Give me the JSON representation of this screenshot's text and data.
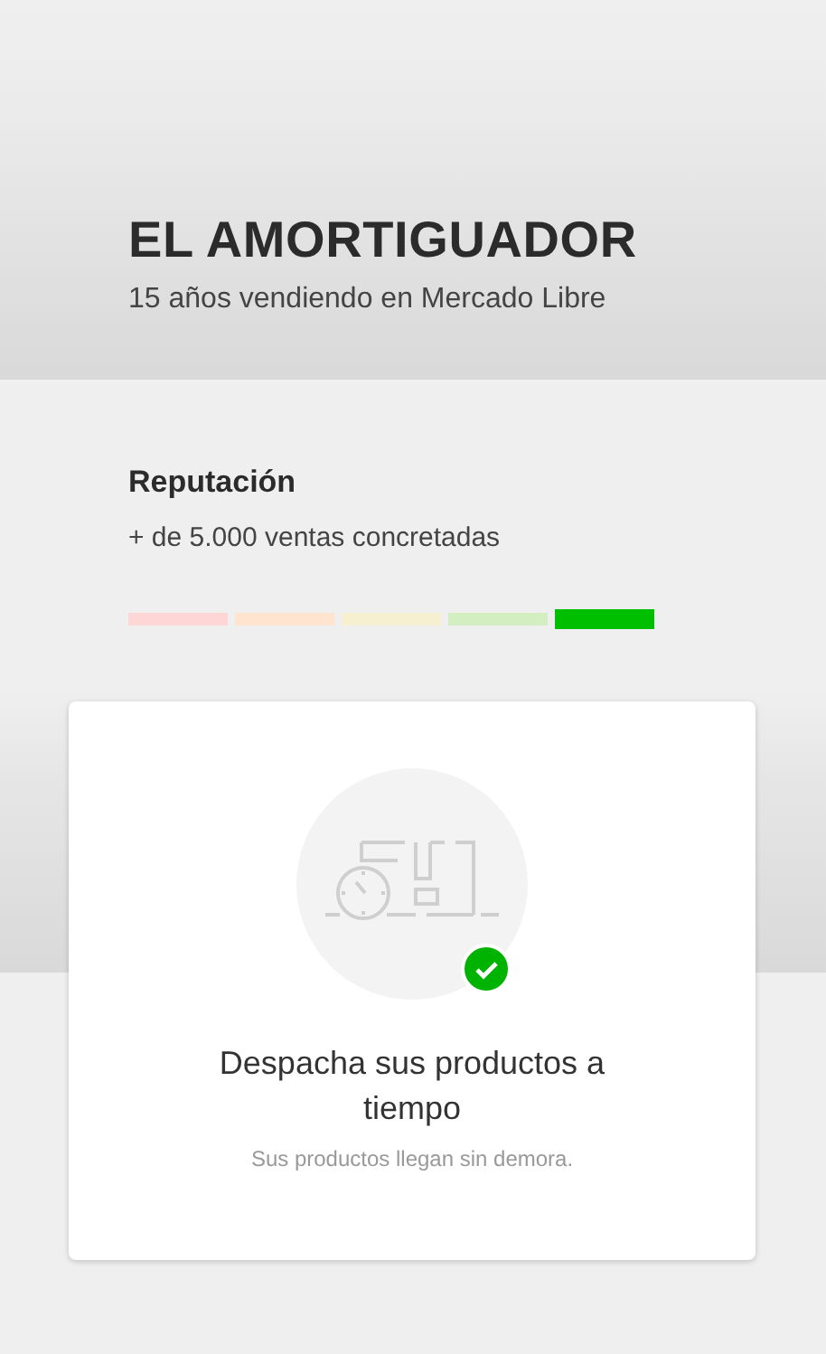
{
  "seller": {
    "name": "EL AMORTIGUADOR",
    "subtitle": "15 años vendiendo en Mercado Libre"
  },
  "reputation": {
    "title": "Reputación",
    "sales": "+ de 5.000 ventas concretadas",
    "levels": [
      {
        "color": "#ffd6d6",
        "selected": false
      },
      {
        "color": "#ffe4cf",
        "selected": false
      },
      {
        "color": "#f6efd0",
        "selected": false
      },
      {
        "color": "#d3efc1",
        "selected": false
      },
      {
        "color": "#00bf00",
        "selected": true
      }
    ]
  },
  "card": {
    "title": "Despacha sus productos a tiempo",
    "description": "Sus productos llegan sin demora.",
    "verified": true
  }
}
